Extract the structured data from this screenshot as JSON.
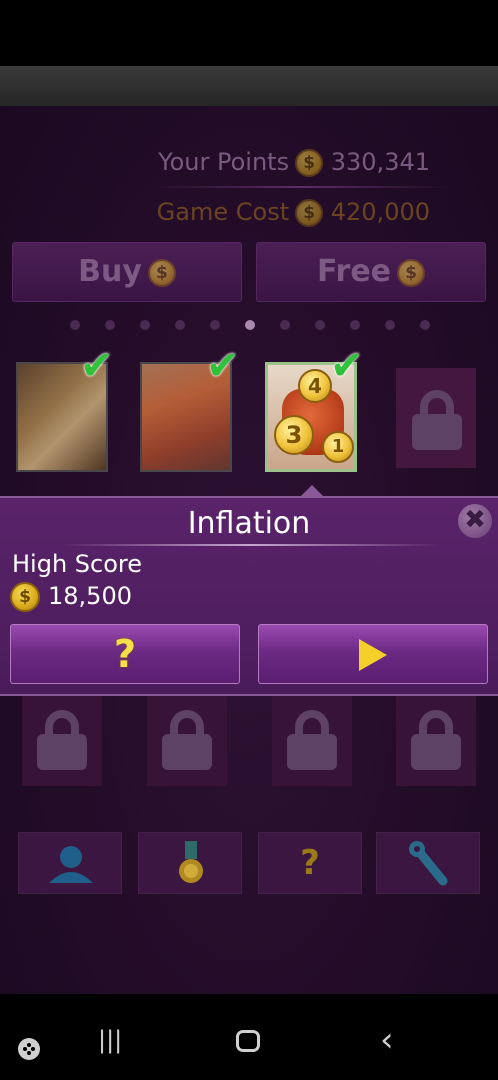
{
  "header": {
    "points_label": "Your Points",
    "points_value": "330,341",
    "cost_label": "Game Cost",
    "cost_value": "420,000",
    "coin_symbol": "$"
  },
  "buttons": {
    "buy_label": "Buy",
    "free_label": "Free"
  },
  "page_indicator": {
    "total": 11,
    "active_index": 5
  },
  "games": [
    {
      "name": "football-game-thumbnail",
      "unlocked": true
    },
    {
      "name": "old-man-game-thumbnail",
      "unlocked": true
    },
    {
      "name": "inflation-game-thumbnail",
      "unlocked": true,
      "selected": true
    },
    {
      "name": "locked-game",
      "unlocked": false
    }
  ],
  "popup": {
    "title": "Inflation",
    "close_symbol": "✖",
    "high_score_label": "High Score",
    "high_score_value": "18,500",
    "help_symbol": "?",
    "coins_on_thumb": [
      "4",
      "3",
      "1"
    ]
  },
  "bottom_toolbar": [
    {
      "icon": "profile-icon"
    },
    {
      "icon": "medal-icon"
    },
    {
      "icon": "help-icon",
      "symbol": "?"
    },
    {
      "icon": "wrench-icon"
    }
  ],
  "nav": {
    "recent": "|||",
    "home": "◯",
    "back": "‹"
  },
  "colors": {
    "background": "#230c28",
    "popup": "#4a1c5a",
    "check": "#2fc23a",
    "coin": "#f0c23a"
  }
}
